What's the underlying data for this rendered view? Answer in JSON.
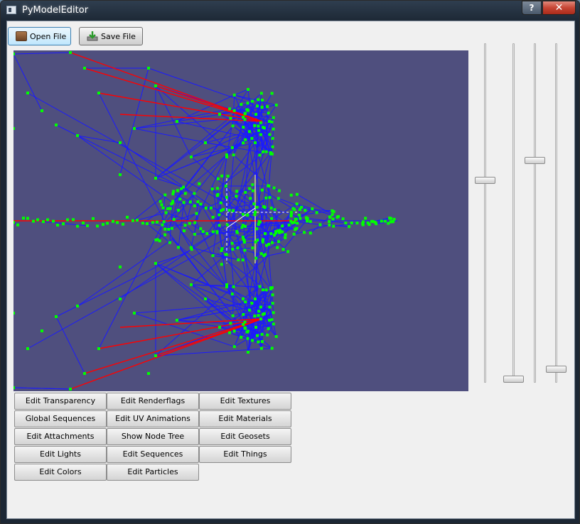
{
  "window": {
    "title": "PyModelEditor",
    "help_label": "?",
    "close_label": "✕"
  },
  "toolbar": {
    "open_label": "Open File",
    "save_label": "Save File"
  },
  "colors": {
    "viewport_background": "#4f4f7e",
    "wireframe": "#1a1aff",
    "vertex": "#00ff00",
    "bone": "#ff0000"
  },
  "sliders": [
    {
      "name": "slider-1",
      "value": 0.6
    },
    {
      "name": "slider-2",
      "value": 0.0
    },
    {
      "name": "slider-3",
      "value": 0.66
    },
    {
      "name": "slider-4",
      "value": 0.03
    }
  ],
  "edit_buttons": [
    [
      "Edit Transparency",
      "Edit Renderflags",
      "Edit Textures"
    ],
    [
      "Global Sequences",
      "Edit UV Animations",
      "Edit Materials"
    ],
    [
      "Edit Attachments",
      "Show Node Tree",
      "Edit Geosets"
    ],
    [
      "Edit Lights",
      "Edit Sequences",
      "Edit Things"
    ],
    [
      "Edit Colors",
      "Edit Particles"
    ]
  ]
}
